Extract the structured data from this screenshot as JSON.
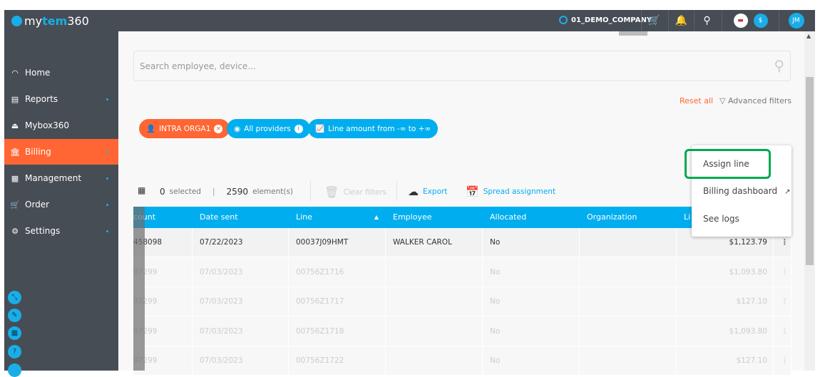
{
  "brand": {
    "pre": "my",
    "bold": "tem",
    "post": "360"
  },
  "topbar": {
    "company": "01_DEMO_COMPANY",
    "icons": [
      "cart-icon",
      "bell-icon",
      "search-icon",
      "flag-us-icon",
      "dollar-icon"
    ],
    "currency": "$",
    "avatar": "JM"
  },
  "sidebar": {
    "items": [
      {
        "label": "Home",
        "icon": "gauge-icon"
      },
      {
        "label": "Reports",
        "icon": "report-icon"
      },
      {
        "label": "Mybox360",
        "icon": "inbox-icon"
      },
      {
        "label": "Billing",
        "icon": "bank-icon",
        "active": true
      },
      {
        "label": "Management",
        "icon": "building-icon"
      },
      {
        "label": "Order",
        "icon": "cart-icon"
      },
      {
        "label": "Settings",
        "icon": "gear-icon"
      }
    ]
  },
  "search": {
    "placeholder": "Search employee, device..."
  },
  "filters": {
    "reset": "Reset all",
    "advanced": "Advanced filters",
    "chips": [
      {
        "label": "INTRA ORGA1",
        "color": "#ff6633"
      },
      {
        "label": "All providers",
        "color": "#00aeef"
      },
      {
        "label": "Line amount from -∞ to +∞",
        "color": "#00aeef"
      }
    ]
  },
  "toolbar": {
    "selected_count": "0",
    "selected_label": "selected",
    "elements_count": "2590",
    "elements_label": "element(s)",
    "clear": "Clear filters",
    "export": "Export",
    "spread": "Spread assignment"
  },
  "table": {
    "columns": [
      "count",
      "Date sent",
      "Line",
      "Employee",
      "Allocated",
      "Organization",
      "Li"
    ],
    "rows": [
      [
        "458098",
        "07/22/2023",
        "00037J09HMT",
        "WALKER CAROL",
        "No",
        "",
        "$1,123.79"
      ],
      [
        "97299",
        "07/03/2023",
        "00756Z1716",
        "",
        "No",
        "",
        "$1,093.80"
      ],
      [
        "97299",
        "07/03/2023",
        "00756Z1717",
        "",
        "No",
        "",
        "$127.10"
      ],
      [
        "97299",
        "07/03/2023",
        "00756Z1718",
        "",
        "No",
        "",
        "$1,093.80"
      ],
      [
        "97299",
        "07/03/2023",
        "00756Z1722",
        "",
        "No",
        "",
        "$127.10"
      ]
    ]
  },
  "menu": {
    "items": [
      "Assign line",
      "Billing dashboard",
      "See logs"
    ]
  },
  "colors": {
    "accent": "#00aeef",
    "active": "#ff6633",
    "highlight": "#00a94f",
    "sidebar": "#474d55"
  }
}
